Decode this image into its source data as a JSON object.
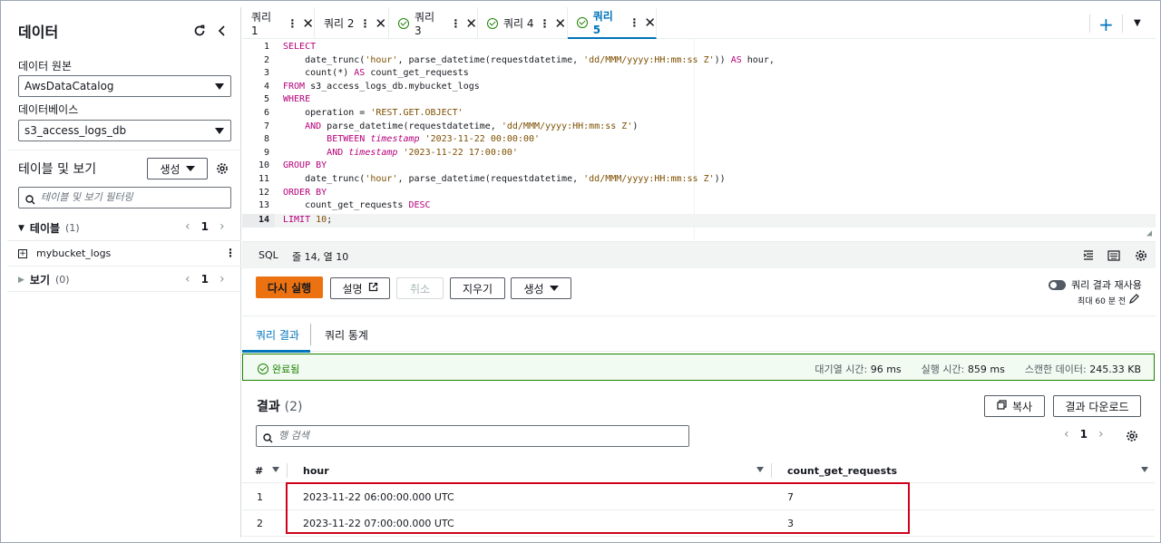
{
  "left_panel": {
    "title": "데이터",
    "data_source_label": "데이터 원본",
    "data_source_value": "AwsDataCatalog",
    "database_label": "데이터베이스",
    "database_value": "s3_access_logs_db",
    "tables_views_title": "테이블 및 보기",
    "create_label": "생성",
    "filter_placeholder": "테이블 및 보기 필터링",
    "tables_label": "테이블",
    "tables_count": "(1)",
    "tables_page": "1",
    "table_item": "mybucket_logs",
    "views_label": "보기",
    "views_count": "(0)",
    "views_page": "1"
  },
  "tabs": [
    {
      "label": "쿼리 1",
      "status": "none"
    },
    {
      "label": "쿼리 2",
      "status": "none"
    },
    {
      "label": "쿼리 3",
      "status": "ok"
    },
    {
      "label": "쿼리 4",
      "status": "ok"
    },
    {
      "label": "쿼리 5",
      "status": "ok",
      "active": true
    }
  ],
  "editor": {
    "lines": [
      "1",
      "2",
      "3",
      "4",
      "5",
      "6",
      "7",
      "8",
      "9",
      "10",
      "11",
      "12",
      "13",
      "14"
    ],
    "current_line": "14"
  },
  "statusbar": {
    "language": "SQL",
    "position": "줄 14, 열 10"
  },
  "actions": {
    "run": "다시 실행",
    "explain": "설명",
    "cancel": "취소",
    "clear": "지우기",
    "create": "생성",
    "reuse_label": "쿼리 결과 재사용",
    "reuse_sub": "최대 60 분 전"
  },
  "result_tabs": {
    "results": "쿼리 결과",
    "stats": "쿼리 통계"
  },
  "banner": {
    "status": "완료됨",
    "queue_label": "대기열 시간:",
    "queue_value": "96 ms",
    "run_label": "실행 시간:",
    "run_value": "859 ms",
    "scan_label": "스캔한 데이터:",
    "scan_value": "245.33 KB"
  },
  "results": {
    "title": "결과",
    "count": "(2)",
    "copy": "복사",
    "download": "결과 다운로드",
    "search_placeholder": "행 검색",
    "page": "1",
    "columns": [
      "#",
      "hour",
      "count_get_requests"
    ],
    "rows": [
      {
        "idx": "1",
        "hour": "2023-11-22 06:00:00.000 UTC",
        "count": "7"
      },
      {
        "idx": "2",
        "hour": "2023-11-22 07:00:00.000 UTC",
        "count": "3"
      }
    ]
  },
  "colors": {
    "accent": "#0073bb",
    "run_button": "#ec7211",
    "success": "#1d8102",
    "highlight": "#d0021b"
  }
}
